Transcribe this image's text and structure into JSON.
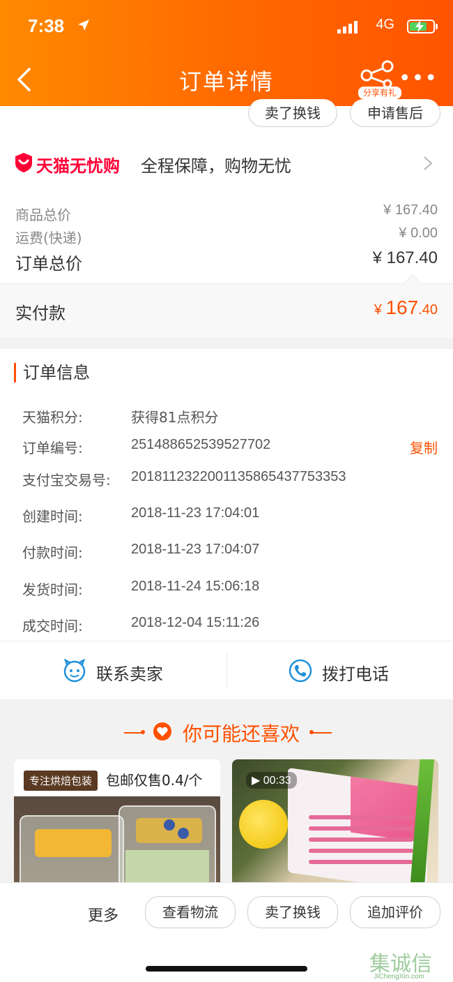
{
  "status_bar": {
    "time": "7:38",
    "network": "4G"
  },
  "nav": {
    "title": "订单详情",
    "share_label": "分享有礼",
    "more_label": "•••"
  },
  "top_actions": {
    "sell_label": "卖了换钱",
    "after_sale_label": "申请售后"
  },
  "tmall": {
    "brand": "天猫无忧购",
    "desc": "全程保障，购物无忧"
  },
  "price": {
    "goods_label": "商品总价",
    "goods_value": "¥ 167.40",
    "shipping_label": "运费(快递)",
    "shipping_value": "¥ 0.00",
    "total_label": "订单总价",
    "total_value": "¥ 167.40",
    "paid_label": "实付款",
    "paid_currency": "¥ ",
    "paid_int": "167",
    "paid_dec": ".40"
  },
  "order_info": {
    "title": "订单信息",
    "copy_label": "复制",
    "rows": [
      {
        "label": "天猫积分:",
        "value": "获得81点积分"
      },
      {
        "label": "订单编号:",
        "value": "251488652539527702"
      },
      {
        "label": "支付宝交易号:",
        "value": "2018112322001135865437753353"
      },
      {
        "label": "创建时间:",
        "value": "2018-11-23 17:04:01"
      },
      {
        "label": "付款时间:",
        "value": "2018-11-23 17:04:07"
      },
      {
        "label": "发货时间:",
        "value": "2018-11-24 15:06:18"
      },
      {
        "label": "成交时间:",
        "value": "2018-12-04 15:11:26"
      }
    ]
  },
  "contact": {
    "seller_label": "联系卖家",
    "phone_label": "拨打电话"
  },
  "recommend": {
    "title": "你可能还喜欢",
    "card1": {
      "badge": "专注烘焙包装",
      "text": "包邮仅售0.4/个"
    },
    "card2": {
      "video_time": "00:33"
    }
  },
  "bottom_bar": {
    "more_label": "更多",
    "logistics_label": "查看物流",
    "sell_label": "卖了换钱",
    "review_label": "追加评价"
  },
  "watermark": {
    "chars": "集诚信",
    "url": "JiChengXin.com"
  },
  "colors": {
    "accent": "#ff5000",
    "header_start": "#ff8a00",
    "header_end": "#ff5400",
    "tmall_red": "#ff0036",
    "contact_blue": "#1e90d8"
  }
}
